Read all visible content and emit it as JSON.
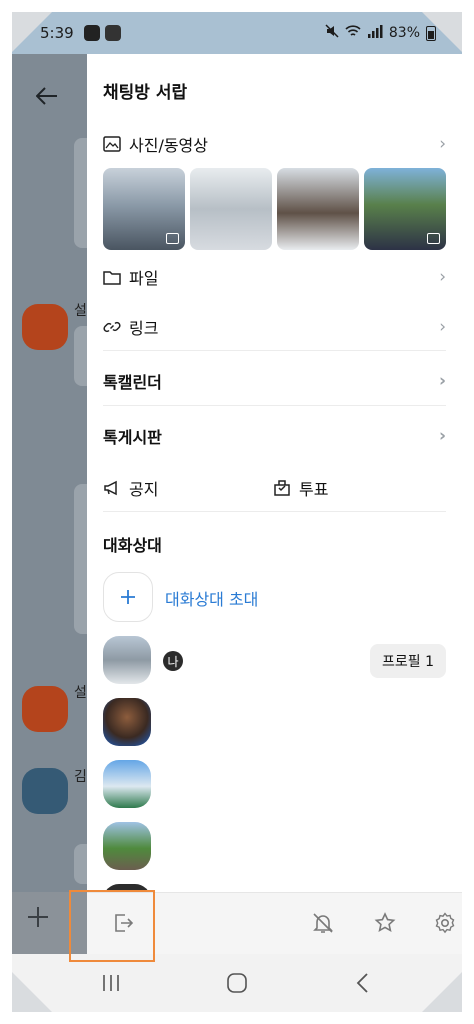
{
  "status_bar": {
    "time": "5:39",
    "battery": "83%"
  },
  "drawer": {
    "title": "채팅방 서랍",
    "photos_label": "사진/동영상",
    "file_label": "파일",
    "link_label": "링크",
    "calendar_label": "톡캘린더",
    "board_label": "톡게시판",
    "notice_label": "공지",
    "vote_label": "투표",
    "members_title": "대화상대",
    "invite_label": "대화상대 초대",
    "me_badge": "나",
    "profile_button": "프로필 1"
  },
  "background_chat": {
    "name_1": "설",
    "name_2": "설",
    "name_3": "김"
  },
  "colors": {
    "accent_blue": "#2a7bd4",
    "highlight_orange": "#ef8a3b"
  },
  "icons": {
    "toolbar": [
      "exit-icon",
      "bell-off-icon",
      "star-icon",
      "gear-icon"
    ],
    "nav": [
      "recents-icon",
      "home-icon",
      "back-icon"
    ]
  }
}
